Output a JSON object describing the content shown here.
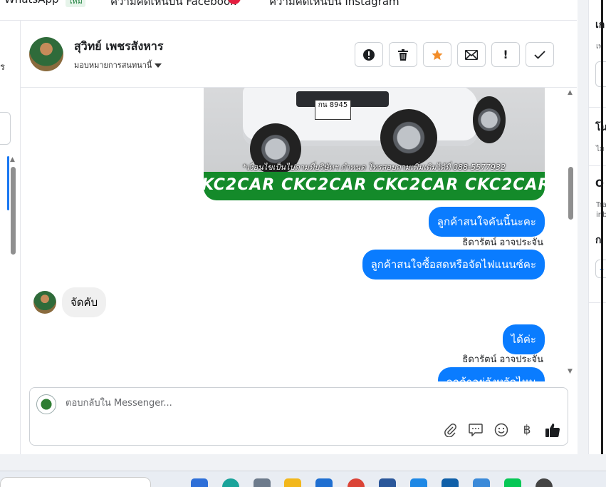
{
  "topbar": {
    "tabs": [
      "WhatsApp",
      "ความคิดเห็นบน Facebook",
      "ความคิดเห็นบน Instagram"
    ],
    "new_badge": "ใหม่"
  },
  "conversation": {
    "contact_name": "สุวิทย์ เพชรสังหาร",
    "assign_label": "มอบหมายการสนทนานี้",
    "actions": [
      "alert-icon",
      "trash-icon",
      "star-icon",
      "mail-icon",
      "exclamation-icon",
      "check-icon"
    ],
    "accent_color": "#0a7cff",
    "star_color": "#f28c28"
  },
  "image_message": {
    "plate": "กน 8945",
    "note": "*เงื่อนไขเป็นไปตามที่บริษัทฯ กำหนด โทรสอบถามเพิ่มเติมได้ที่ 088-5577932",
    "banner": "CKC2CAR CKC2CAR CKC2CAR CKC2CAR CKC2CAR"
  },
  "messages": [
    {
      "dir": "out",
      "text": "ลูกค้าสนใจคันนี้นะคะ",
      "sender": "ธิดารัตน์ อาจประจัน"
    },
    {
      "dir": "out",
      "text": "ลูกค้าสนใจซื้อสดหรือจัดไฟแนนซ์คะ"
    },
    {
      "dir": "in",
      "text": "จัดคับ"
    },
    {
      "dir": "out",
      "text": "ได้ค่ะ",
      "sender": "ธิดารัตน์ อาจประจัน"
    },
    {
      "dir": "out",
      "text": "ลูกค้าอยู่จังหวัดไหน"
    }
  ],
  "composer": {
    "placeholder": "ตอบกลับใน Messenger...",
    "tools": [
      "paperclip-icon",
      "saved-reply-icon",
      "emoji-icon",
      "baht-icon",
      "thumbs-up-icon"
    ]
  },
  "right_panel": {
    "heading1": "เก",
    "sub1": "เพ",
    "heading2": "โน",
    "sub2": "ไม",
    "heading3": "O",
    "sub3a": "Tra",
    "sub3b": "inb",
    "heading4": "ก"
  },
  "left_panel": {
    "partial_text": "ร"
  }
}
